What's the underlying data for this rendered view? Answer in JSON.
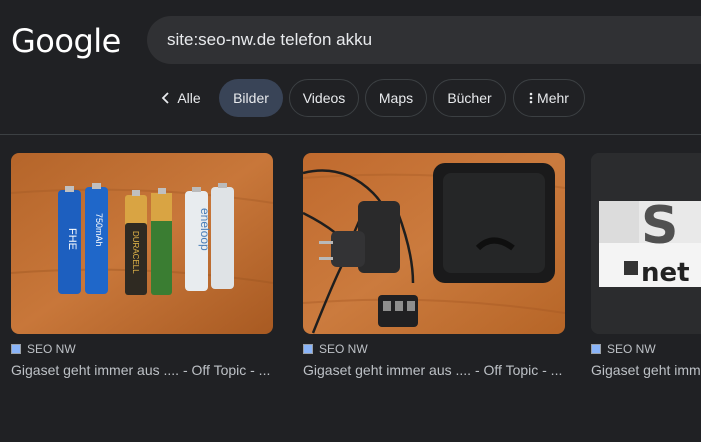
{
  "logo": {
    "text": "Google"
  },
  "search": {
    "query": "site:seo-nw.de telefon akku"
  },
  "tabs": {
    "back_label": "Alle",
    "items": [
      {
        "label": "Bilder",
        "active": true
      },
      {
        "label": "Videos"
      },
      {
        "label": "Maps"
      },
      {
        "label": "Bücher"
      },
      {
        "label": "Mehr"
      }
    ]
  },
  "results": [
    {
      "source": "SEO NW",
      "title": "Gigaset geht immer aus .... - Off Topic - ...",
      "image_text": [
        "FHE",
        "750mAh",
        "DURACELL",
        "eneloop"
      ]
    },
    {
      "source": "SEO NW",
      "title": "Gigaset geht immer aus .... - Off Topic - ..."
    },
    {
      "source": "SEO NW",
      "title": "Gigaset geht imm",
      "image_text": [
        "S",
        "net"
      ]
    }
  ],
  "colors": {
    "background": "#202124",
    "search_bg": "#303134",
    "chip_active": "#394457",
    "chip_border": "#3c4043",
    "text_primary": "#e8eaed",
    "text_secondary": "#bdc1c6"
  },
  "icons": {
    "back": "chevron-left-icon",
    "more": "vertical-dots-icon",
    "favicon": "site-favicon-icon"
  }
}
